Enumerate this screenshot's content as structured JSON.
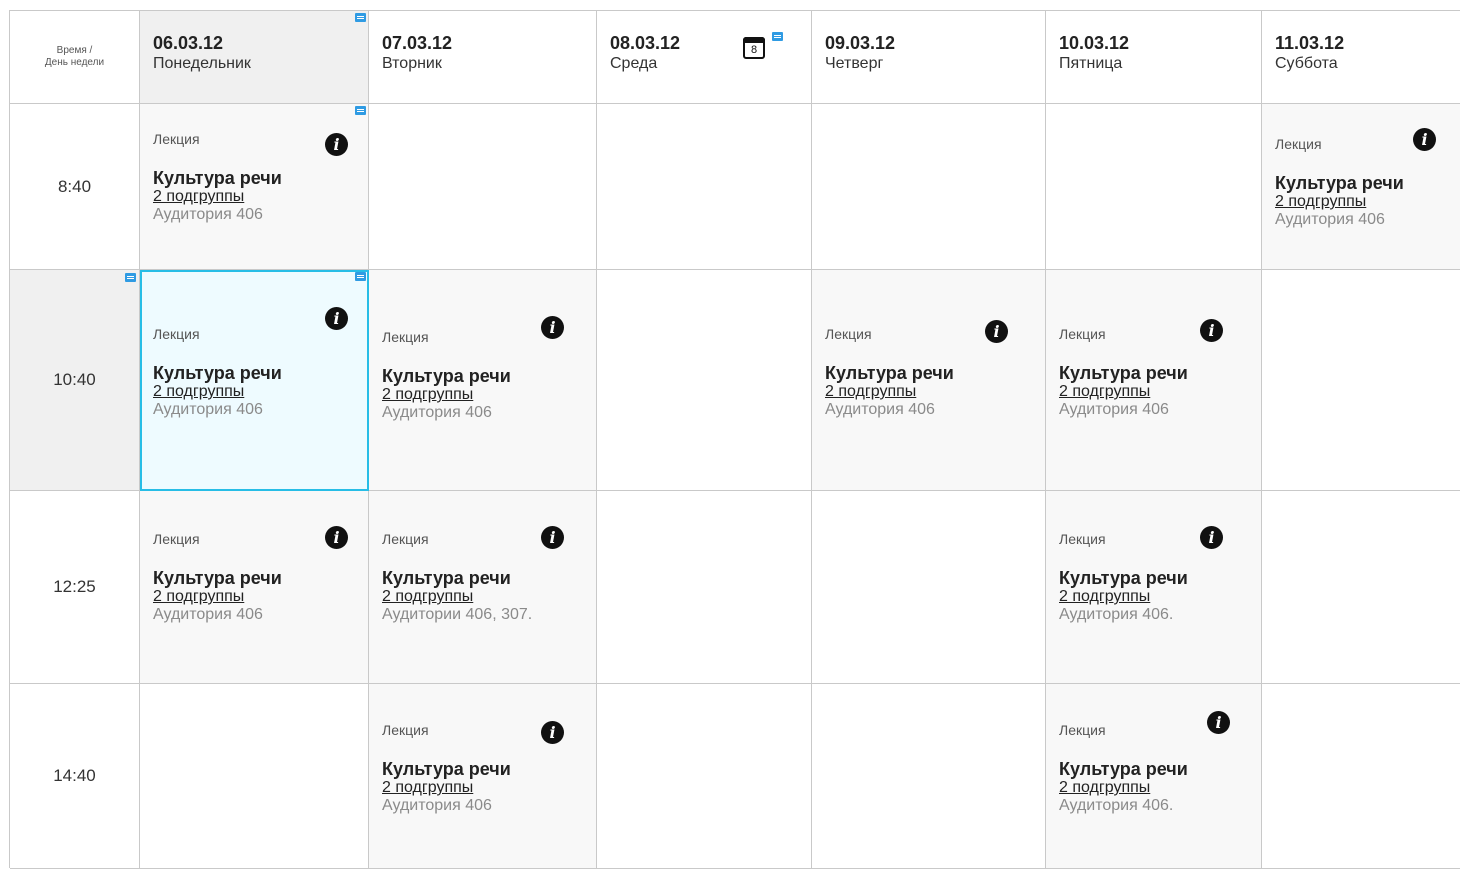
{
  "corner": {
    "line1": "Время /",
    "line2": "День недели"
  },
  "days": [
    {
      "date": "06.03.12",
      "name": "Понедельник"
    },
    {
      "date": "07.03.12",
      "name": "Вторник"
    },
    {
      "date": "08.03.12",
      "name": "Среда",
      "calendar_icon_number": "8"
    },
    {
      "date": "09.03.12",
      "name": "Четверг"
    },
    {
      "date": "10.03.12",
      "name": "Пятница"
    },
    {
      "date": "11.03.12",
      "name": "Суббота"
    }
  ],
  "times": [
    "8:40",
    "10:40",
    "12:25",
    "14:40"
  ],
  "lessons": {
    "r0d0": {
      "type": "Лекция",
      "subject": "Культура речи",
      "groups": "2 подгруппы",
      "room": "Аудитория 406"
    },
    "r0d5": {
      "type": "Лекция",
      "subject": "Культура речи",
      "groups": "2 подгруппы",
      "room": "Аудитория 406"
    },
    "r1d0": {
      "type": "Лекция",
      "subject": "Культура речи",
      "groups": "2 подгруппы",
      "room": "Аудитория 406"
    },
    "r1d1": {
      "type": "Лекция",
      "subject": "Культура речи",
      "groups": "2 подгруппы",
      "room": "Аудитория 406"
    },
    "r1d3": {
      "type": "Лекция",
      "subject": "Культура речи",
      "groups": "2 подгруппы",
      "room": "Аудитория 406"
    },
    "r1d4": {
      "type": "Лекция",
      "subject": "Культура речи",
      "groups": "2 подгруппы",
      "room": "Аудитория 406"
    },
    "r2d0": {
      "type": "Лекция",
      "subject": "Культура речи",
      "groups": "2 подгруппы",
      "room": "Аудитория 406"
    },
    "r2d1": {
      "type": "Лекция",
      "subject": "Культура речи",
      "groups": "2 подгруппы",
      "room": "Аудитории 406, 307."
    },
    "r2d4": {
      "type": "Лекция",
      "subject": "Культура речи",
      "groups": "2 подгруппы",
      "room": "Аудитория 406."
    },
    "r3d1": {
      "type": "Лекция",
      "subject": "Культура речи",
      "groups": "2 подгруппы",
      "room": "Аудитория 406"
    },
    "r3d4": {
      "type": "Лекция",
      "subject": "Культура речи",
      "groups": "2 подгруппы",
      "room": "Аудитория 406."
    }
  },
  "icons": {
    "info": "info-icon",
    "note": "note-icon",
    "calendar": "calendar-icon"
  },
  "colors": {
    "selected_border": "#27bde6",
    "note_icon": "#2f9be3",
    "cell_filled": "#f8f8f8",
    "cell_gray": "#f0f0f0"
  }
}
